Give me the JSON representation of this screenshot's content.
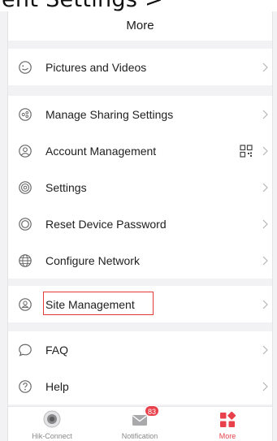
{
  "caption": {
    "text": "ent Settings >"
  },
  "header": {
    "title": "More"
  },
  "menu": {
    "pictures_videos": "Pictures and Videos",
    "manage_sharing": "Manage Sharing Settings",
    "account_management": "Account Management",
    "settings": "Settings",
    "reset_password": "Reset Device Password",
    "configure_network": "Configure Network",
    "site_management": "Site Management",
    "faq": "FAQ",
    "help": "Help"
  },
  "tabbar": {
    "tabs": [
      {
        "label": "Hik-Connect",
        "icon": "camera-icon",
        "active": false
      },
      {
        "label": "Notification",
        "icon": "envelope-icon",
        "active": false,
        "badge": "83"
      },
      {
        "label": "More",
        "icon": "grid-icon",
        "active": true
      }
    ]
  },
  "colors": {
    "accent": "#e8414b",
    "highlight_border": "#e53935",
    "icon_gray": "#666666",
    "background": "#f2f2f4"
  }
}
